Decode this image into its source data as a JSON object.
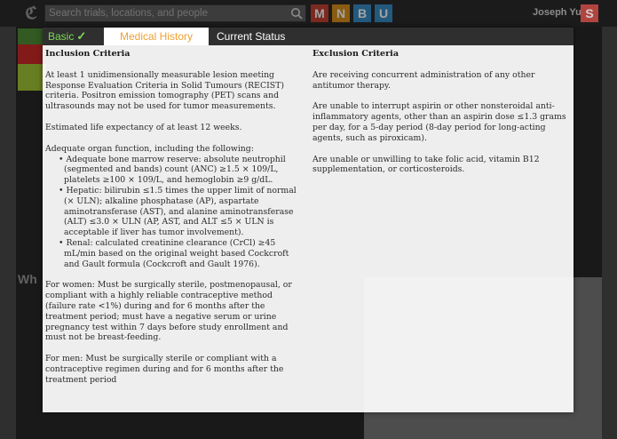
{
  "app": {
    "search_placeholder": "Search trials, locations, and people",
    "tiles": [
      {
        "letter": "M",
        "color": "#c0392b"
      },
      {
        "letter": "N",
        "color": "#d68910"
      },
      {
        "letter": "B",
        "color": "#2e86c1"
      },
      {
        "letter": "U",
        "color": "#2e86c1"
      }
    ],
    "user_name": "Joseph Yu",
    "avatar_letter": "S",
    "bg_heading": "Wh"
  },
  "modal": {
    "tabs": {
      "basic": "Basic",
      "medical_history": "Medical History",
      "current_status": "Current Status"
    },
    "inclusion": {
      "heading": "Inclusion Criteria",
      "p1": "At least 1 unidimensionally measurable lesion meeting Response Evaluation Criteria in Solid Tumours (RECIST) criteria. Positron emission tomography (PET) scans and ultrasounds may not be used for tumor measurements.",
      "p2": "Estimated life expectancy of at least 12 weeks.",
      "p3_intro": "Adequate organ function, including the following:",
      "organ_items": [
        "Adequate bone marrow reserve: absolute neutrophil (segmented and bands) count (ANC) ≥1.5 × 109/L, platelets ≥100 × 109/L, and hemoglobin ≥9 g/dL.",
        "Hepatic: bilirubin ≤1.5 times the upper limit of normal (× ULN); alkaline phosphatase (AP), aspartate aminotransferase (AST), and alanine aminotransferase (ALT) ≤3.0 × ULN (AP, AST, and ALT ≤5 × ULN is acceptable if liver has tumor involvement).",
        "Renal: calculated creatinine clearance (CrCl) ≥45 mL/min based on the original weight based Cockcroft and Gault formula (Cockcroft and Gault 1976)."
      ],
      "p4": "For women: Must be surgically sterile, postmenopausal, or compliant with a highly reliable contraceptive method (failure rate <1%) during and for 6 months after the treatment period; must have a negative serum or urine pregnancy test within 7 days before study enrollment and must not be breast-feeding.",
      "p5": "For men: Must be surgically sterile or compliant with a contraceptive regimen during and for 6 months after the treatment period"
    },
    "exclusion": {
      "heading": "Exclusion Criteria",
      "p1": "Are receiving concurrent administration of any other antitumor therapy.",
      "p2": "Are unable to interrupt aspirin or other nonsteroidal anti-inflammatory agents, other than an aspirin dose ≤1.3 grams per day, for a 5-day period (8-day period for long-acting agents, such as piroxicam).",
      "p3": "Are unable or unwilling to take folic acid, vitamin B12 supplementation, or corticosteroids."
    }
  }
}
